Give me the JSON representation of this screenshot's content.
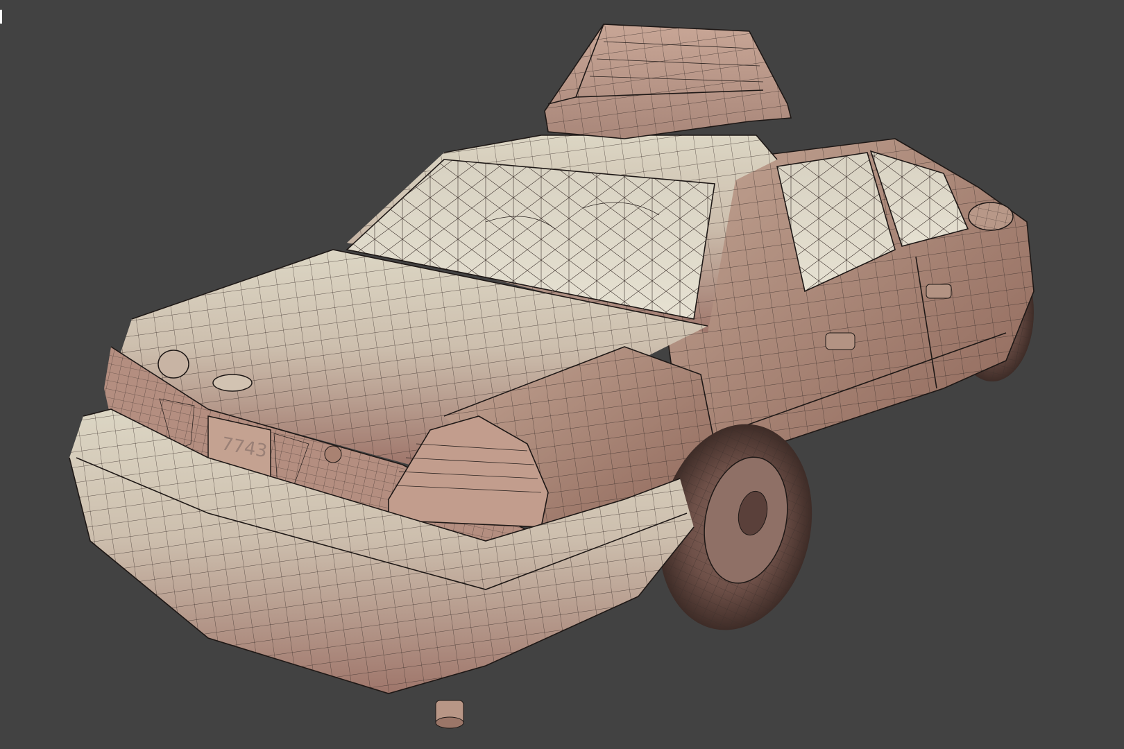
{
  "viewport": {
    "background_color": "#424242",
    "render_mode": "shaded-wireframe"
  },
  "model": {
    "body_color_light": "#d9d3c1",
    "body_color_dark": "#a87e72",
    "wire_color": "#2b2320",
    "license_plate_text": "7743"
  }
}
